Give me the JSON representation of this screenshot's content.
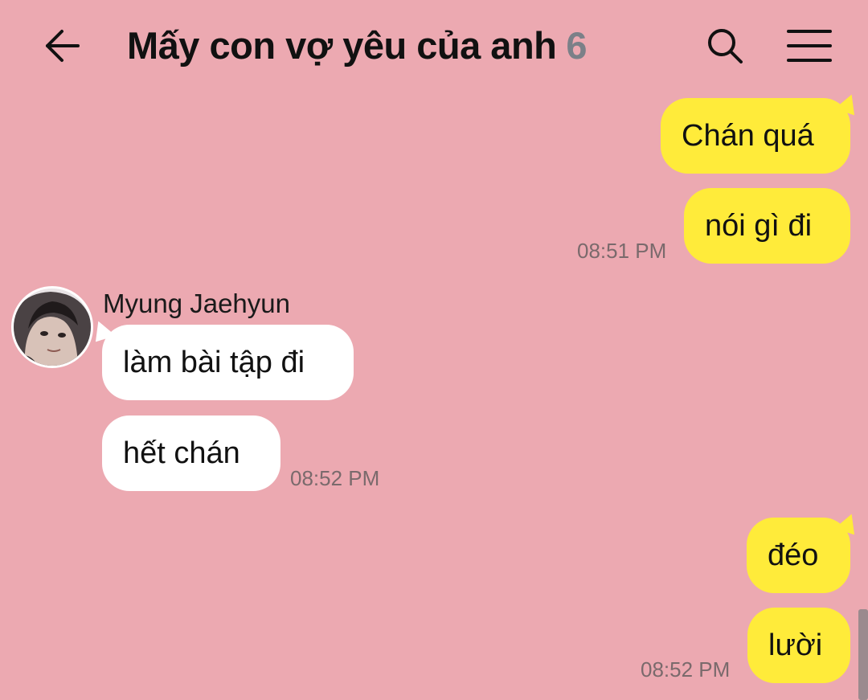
{
  "header": {
    "back_icon": "arrow-left-icon",
    "title": "Mấy con vợ yêu của anh",
    "member_count": "6",
    "search_icon": "search-icon",
    "menu_icon": "hamburger-menu-icon"
  },
  "colors": {
    "background": "#eca9b1",
    "my_bubble": "#ffeb3a",
    "their_bubble": "#ffffff",
    "timestamp": "#7a6a6c",
    "member_count": "#7b8088"
  },
  "messages": {
    "m1": {
      "text": "Chán quá",
      "sender": "me"
    },
    "m2": {
      "text": "nói gì đi",
      "sender": "me",
      "time": "08:51 PM"
    },
    "m3": {
      "text": "làm bài tập đi",
      "sender": "Myung Jaehyun"
    },
    "m4": {
      "text": "hết chán",
      "sender": "Myung Jaehyun",
      "time": "08:52 PM"
    },
    "m5": {
      "text": "đéo",
      "sender": "me"
    },
    "m6": {
      "text": "lười",
      "sender": "me",
      "time": "08:52 PM"
    }
  },
  "sender": {
    "name": "Myung Jaehyun"
  }
}
